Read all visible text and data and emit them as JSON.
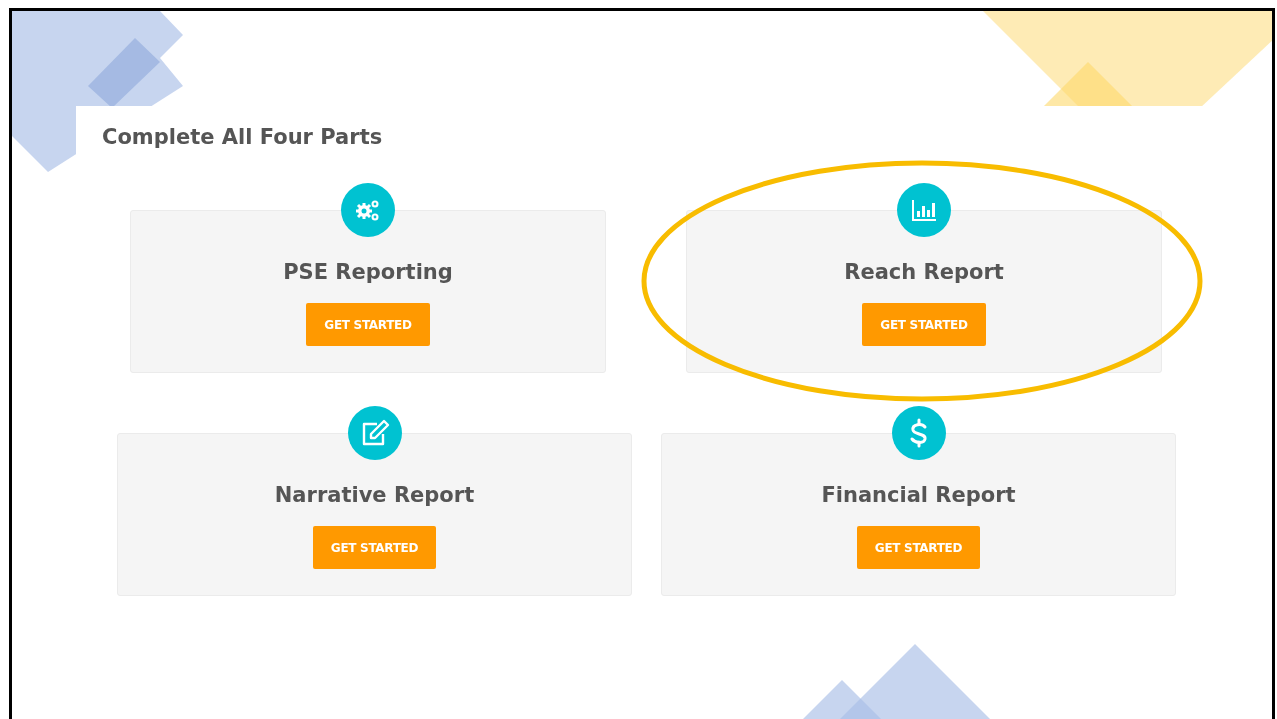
{
  "heading": "Complete All Four Parts",
  "parts": [
    {
      "title": "PSE Reporting",
      "button": "GET STARTED",
      "highlighted": false
    },
    {
      "title": "Reach Report",
      "button": "GET STARTED",
      "highlighted": true
    },
    {
      "title": "Narrative Report",
      "button": "GET STARTED",
      "highlighted": false
    },
    {
      "title": "Financial Report",
      "button": "GET STARTED",
      "highlighted": false
    }
  ]
}
